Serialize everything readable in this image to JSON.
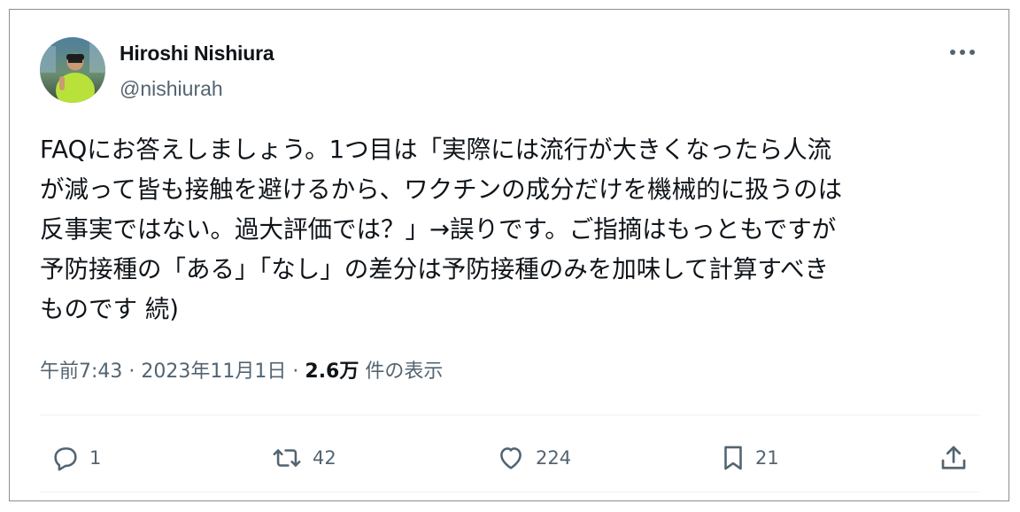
{
  "author": {
    "name": "Hiroshi Nishiura",
    "handle": "@nishiurah"
  },
  "tweet": {
    "lines": [
      "FAQにお答えしましょう。1つ目は「実際には流行が大きくなったら人流",
      "が減って皆も接触を避けるから、ワクチンの成分だけを機械的に扱うのは",
      "反事実ではない。過大評価では？」→誤りです。ご指摘はもっともですが",
      "予防接種の「ある」「なし」の差分は予防接種のみを加味して計算すべき",
      "ものです 続)"
    ]
  },
  "meta": {
    "time": "午前7:43",
    "date": "2023年11月1日",
    "views_count": "2.6万",
    "views_label": "件の表示"
  },
  "actions": {
    "replies": "1",
    "reposts": "42",
    "likes": "224",
    "bookmarks": "21"
  },
  "icons": [
    "more-icon",
    "reply-icon",
    "repost-icon",
    "like-icon",
    "bookmark-icon",
    "share-icon"
  ],
  "colors": {
    "text": "#0f1419",
    "secondary": "#536471",
    "avatar_shirt": "#b8e23a"
  }
}
